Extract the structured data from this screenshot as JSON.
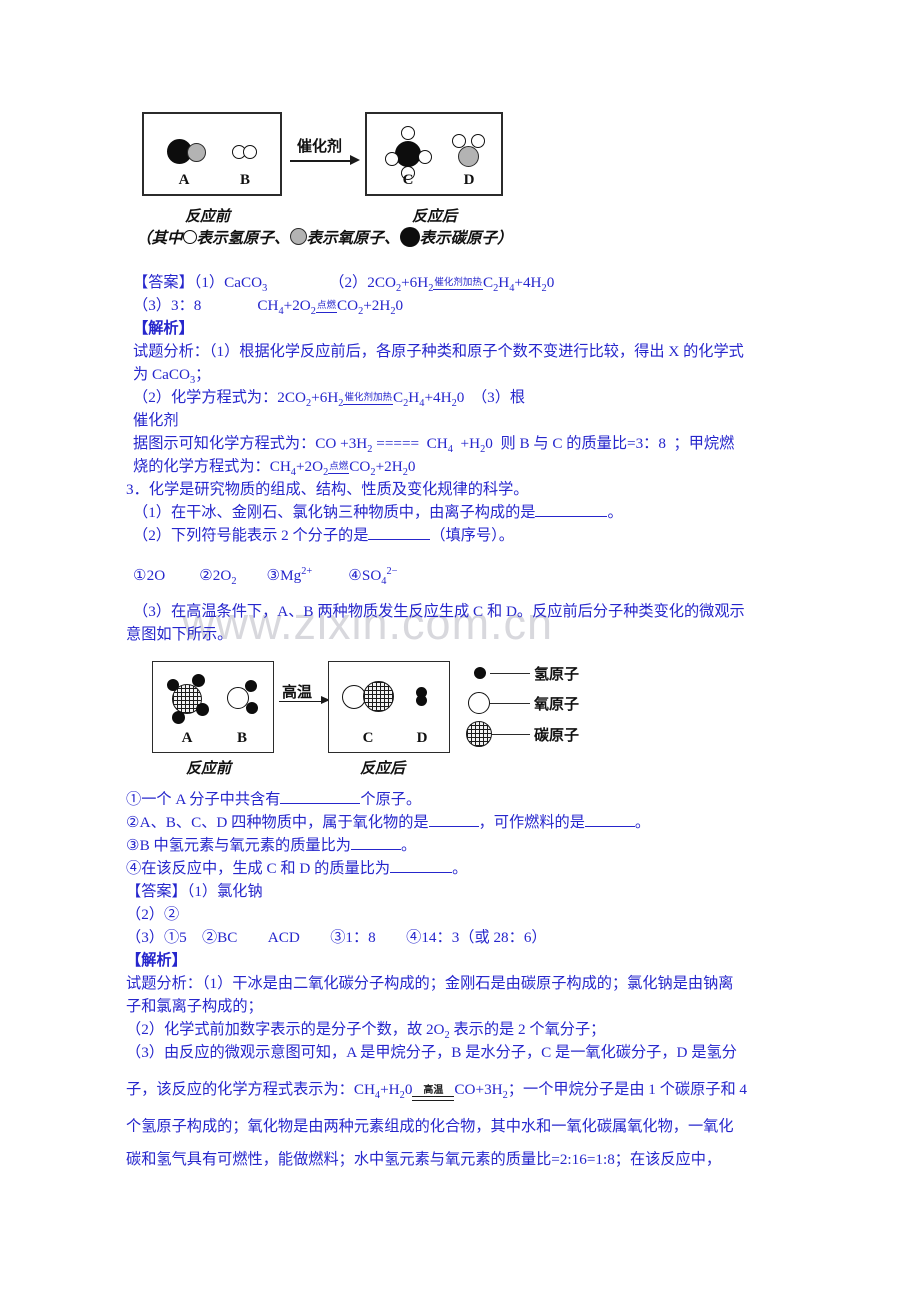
{
  "page": {
    "watermark": "www.zixin.com.cn",
    "text_color": "#2626cc",
    "ink_color": "#111111"
  },
  "diagram1": {
    "name": "co-h2-to-ch4-h2o-microscopic-diagram",
    "condition_label": "催化剂",
    "before_label": "反应前",
    "after_label": "反应后",
    "legend_caption": "（其中〇表示氢原子、〇表示氧原子、●表示碳原子）",
    "legend_caption_part1": "（其中",
    "legend_caption_part2": "表示氢原子、",
    "legend_caption_part3": "表示氧原子、",
    "legend_caption_part4": "表示碳原子）",
    "molecules": [
      {
        "label": "A",
        "formula": "CO"
      },
      {
        "label": "B",
        "formula": "H2"
      },
      {
        "label": "C",
        "formula": "CH4"
      },
      {
        "label": "D",
        "formula": "H2O"
      }
    ]
  },
  "answer_block_1": {
    "tag": "【答案】",
    "line1_q1": "（1）CaCO",
    "line1_q1_sub": "3",
    "line1_q2_prefix": "（2）2CO",
    "line1_q2": "2CO₂+6H₂ 催化剂加热 C₂H₄+4H₂O",
    "condition": "催化剂加热",
    "line2_q3": "（3）3：8",
    "line2_eq": "CH₄+2O₂ 点燃 CO₂+2H₂O",
    "line2_condition": "点燃"
  },
  "explain_block_1": {
    "tag": "【解析】",
    "line1": "试题分析：（1）根据化学反应前后，各原子种类和原子个数不变进行比较，得出 X 的化学式",
    "line2": "为 CaCO₃；",
    "line3": "（2）化学方程式为：2CO₂+6H₂ 催化剂加热 C₂H₄+4H₂O　（3）根",
    "line4": "催化剂",
    "line5": "据图示可知化学方程式为：CO +3H₂ =====　CH₄　+H₂O　则 B 与 C 的质量比=3：8　；甲烷燃",
    "line6": "烧的化学方程式为：CH₄+2O₂ 点燃 CO₂+2H₂O"
  },
  "question3": {
    "number": "3．",
    "stem": "化学是研究物质的组成、结构、性质及变化规律的科学。",
    "sub1": "（1）在干冰、金刚石、氯化钠三种物质中，由离子构成的是",
    "sub1_end": "。",
    "sub2": "（2）下列符号能表示 2 个分子的是",
    "sub2_end": "（填序号）。",
    "options": [
      {
        "marker": "①",
        "text": "2O"
      },
      {
        "marker": "②",
        "text": "2O₂"
      },
      {
        "marker": "③",
        "text": "Mg²⁺"
      },
      {
        "marker": "④",
        "text": "SO₄²⁻"
      }
    ],
    "sub3_line1": "（3）在高温条件下，A、B 两种物质发生反应生成 C 和 D。反应前后分子种类变化的微观示",
    "sub3_line2": "意图如下所示。"
  },
  "diagram2": {
    "name": "ch4-h2o-to-co-h2-microscopic-diagram",
    "condition_label": "高温",
    "before_label": "反应前",
    "after_label": "反应后",
    "legend": [
      {
        "icon": "small-black-circle",
        "label": "氢原子"
      },
      {
        "icon": "large-white-circle",
        "label": "氧原子"
      },
      {
        "icon": "large-hatched-circle",
        "label": "碳原子"
      }
    ],
    "molecules": [
      {
        "label": "A",
        "formula": "CH4"
      },
      {
        "label": "B",
        "formula": "H2O"
      },
      {
        "label": "C",
        "formula": "CO"
      },
      {
        "label": "D",
        "formula": "H2"
      }
    ]
  },
  "question3_parts": {
    "p1": "①一个 A 分子中共含有",
    "p1_end": "个原子。",
    "p2": "②A、B、C、D 四种物质中，属于氧化物的是",
    "p2_mid": "，可作燃料的是",
    "p2_end": "。",
    "p3": "③B 中氢元素与氧元素的质量比为",
    "p3_end": "。",
    "p4": "④在该反应中，生成 C 和 D 的质量比为",
    "p4_end": "。"
  },
  "answer_block_2": {
    "tag": "【答案】",
    "line1": "（1）氯化钠",
    "line2": "（2）②",
    "line3": "（3）①5　②BC　　ACD　　③1：8　　④14：3（或 28：6）"
  },
  "explain_block_2": {
    "tag": "【解析】",
    "line1": "试题分析：（1）干冰是由二氧化碳分子构成的；金刚石是由碳原子构成的；氯化钠是由钠离",
    "line2": "子和氯离子构成的；",
    "line3": "（2）化学式前加数字表示的是分子个数，故 2O₂ 表示的是 2 个氧分子；",
    "line4": "（3）由反应的微观示意图可知，A 是甲烷分子，B 是水分子，C 是一氧化碳分子，D 是氢分",
    "line5a": "子，该反应的化学方程式表示为：CH₄+H₂O",
    "line5_cond": "高温",
    "line5b": "CO+3H₂；一个甲烷分子是由 1 个碳原子和 4",
    "line6": "个氢原子构成的；氧化物是由两种元素组成的化合物，其中水和一氧化碳属氧化物，一氧化",
    "line7": "碳和氢气具有可燃性，能做燃料；水中氢元素与氧元素的质量比=2:16=1:8；在该反应中，"
  }
}
